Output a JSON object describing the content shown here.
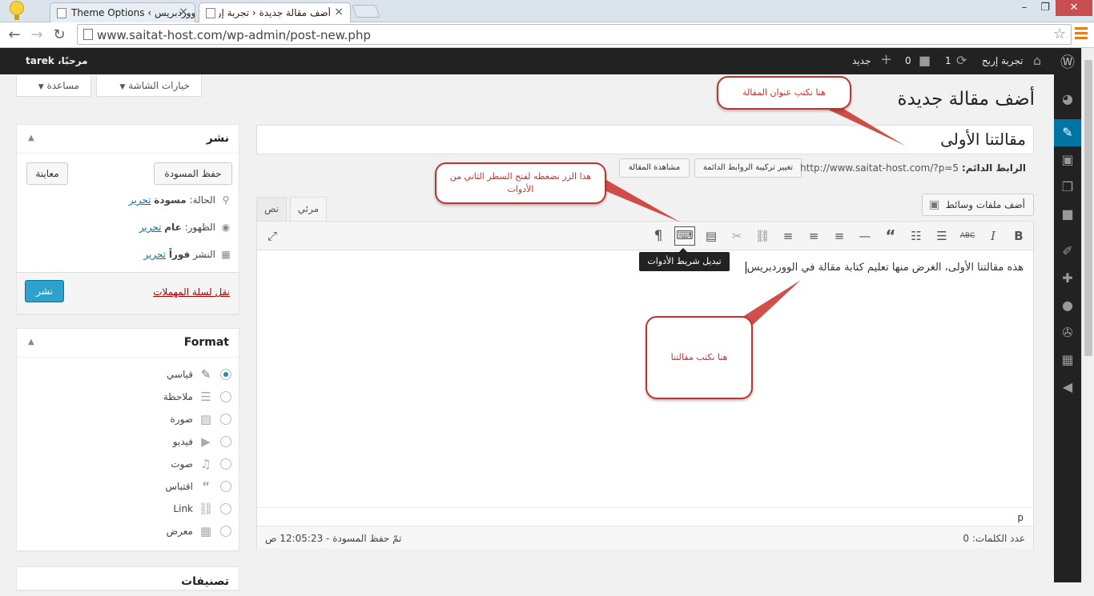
{
  "browser": {
    "tabs": [
      {
        "title": "Theme Options ‹ ووردبريس"
      },
      {
        "title": "أضف مقالة جديدة ‹ تجربة إربح"
      }
    ],
    "url": "www.saitat-host.com/wp-admin/post-new.php",
    "window_controls": {
      "minimize": "–",
      "maximize": "❐",
      "close": "✕"
    }
  },
  "adminbar": {
    "site_name": "تجربة إربح",
    "updates_count": "1",
    "comments_count": "0",
    "new_label": "جديد",
    "greeting": "مرحبًا، tarek"
  },
  "screen_meta": {
    "screen_options": "خيارات الشاشة",
    "help": "مساعدة"
  },
  "page": {
    "title": "أضف مقالة جديدة"
  },
  "post": {
    "title_value": "مقالتنا الأولى",
    "permalink_label": "الرابط الدائم:",
    "permalink_url": "http://www.saitat-host.com/?p=5",
    "change_permalinks": "تغيير تركيبة الروابط الدائمة",
    "view_post": "مشاهدة المقالة",
    "body_text": "هذه مقالتنا الأولى، الغرض منها تعليم كتابة مقالة في الووردبريس"
  },
  "editor": {
    "add_media": "أضف ملفات وسائط",
    "tab_visual": "مرئي",
    "tab_text": "نص",
    "tooltip": "تبديل شريط الأدوات",
    "path": "p",
    "word_count": "عدد الكلمات: 0",
    "draft_saved": "تمّ حفظ المسودة - 12:05:23 ص"
  },
  "publish_box": {
    "title": "نشر",
    "save_draft": "حفظ المسودة",
    "preview": "معاينة",
    "status_label": "الحالة:",
    "status_value": "مسودة",
    "visibility_label": "الظهور:",
    "visibility_value": "عام",
    "publish_label": "النشر",
    "publish_value": "فوراً",
    "edit": "تحرير",
    "trash": "نقل لسلة المهملات",
    "publish": "نشر",
    "trash_color": "#a00"
  },
  "format_box": {
    "title": "Format",
    "options": [
      {
        "label": "قياسي",
        "icon": "pin-icon",
        "selected": true
      },
      {
        "label": "ملاحظة",
        "icon": "aside-icon",
        "selected": false
      },
      {
        "label": "صورة",
        "icon": "image-icon",
        "selected": false
      },
      {
        "label": "فيديو",
        "icon": "video-icon",
        "selected": false
      },
      {
        "label": "صوت",
        "icon": "audio-icon",
        "selected": false
      },
      {
        "label": "اقتباس",
        "icon": "quote-icon",
        "selected": false
      },
      {
        "label": "Link",
        "icon": "link-icon",
        "selected": false
      },
      {
        "label": "معرض",
        "icon": "gallery-icon",
        "selected": false
      }
    ]
  },
  "next_box_title": "تصنيفات",
  "callouts": {
    "title_note": "هنا نكتب عنوان المقالة",
    "toolbar_note": "هذا الزر نضغطه لفتح السطر الثاني من الأدوات",
    "body_note": "هنا نكتب مقالتنا"
  },
  "colors": {
    "admin_bar": "#222222",
    "accent": "#0074a2",
    "callout_red": "#c9302c"
  }
}
